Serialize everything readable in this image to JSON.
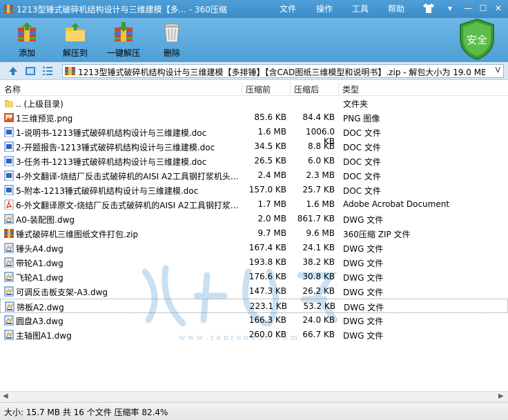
{
  "window": {
    "title": "1213型锤式破碎机结构设计与三维建模【多...  - 360压缩",
    "menu": [
      "文件",
      "操作",
      "工具",
      "帮助"
    ],
    "controls": {
      "minimize": "—",
      "maximize": "☐",
      "close": "✕"
    }
  },
  "toolbar": {
    "buttons": [
      {
        "label": "添加",
        "icon": "add-archive-icon"
      },
      {
        "label": "解压到",
        "icon": "extract-to-icon"
      },
      {
        "label": "一键解压",
        "icon": "one-click-extract-icon"
      },
      {
        "label": "删除",
        "icon": "delete-trash-icon"
      }
    ],
    "security_badge": "安全"
  },
  "address": {
    "path": "1213型锤式破碎机结构设计与三维建模【多排锤】【含CAD图纸三维模型和说明书】.zip - 解包大小为 19.0 MB",
    "dropdown": "V"
  },
  "columns": {
    "name": "名称",
    "size": "压缩前",
    "compressed": "压缩后",
    "type": "类型"
  },
  "files": [
    {
      "name": ".. (上级目录)",
      "size": "",
      "compressed": "",
      "type": "文件夹",
      "icon": "folder-icon"
    },
    {
      "name": "1三维预览.png",
      "size": "85.6 KB",
      "compressed": "84.4 KB",
      "type": "PNG 图像",
      "icon": "png-icon"
    },
    {
      "name": "1-说明书-1213锤式破碎机结构设计与三维建模.doc",
      "size": "1.6 MB",
      "compressed": "1006.0 KB",
      "type": "DOC 文件",
      "icon": "doc-icon"
    },
    {
      "name": "2-开题报告-1213锤式破碎机结构设计与三维建模.doc",
      "size": "34.5 KB",
      "compressed": "8.8 KB",
      "type": "DOC 文件",
      "icon": "doc-icon"
    },
    {
      "name": "3-任务书-1213锤式破碎机结构设计与三维建模.doc",
      "size": "26.5 KB",
      "compressed": "6.0 KB",
      "type": "DOC 文件",
      "icon": "doc-icon"
    },
    {
      "name": "4-外文翻译-烧结厂反击式破碎机的AISI A2工具钢打浆机头...",
      "size": "2.4 MB",
      "compressed": "2.3 MB",
      "type": "DOC 文件",
      "icon": "doc-icon"
    },
    {
      "name": "5-附本-1213锤式破碎机结构设计与三维建模.doc",
      "size": "157.0 KB",
      "compressed": "25.7 KB",
      "type": "DOC 文件",
      "icon": "doc-icon"
    },
    {
      "name": "6-外文翻译原文-烧结厂反击式破碎机的AISI A2工具钢打浆...",
      "size": "1.7 MB",
      "compressed": "1.6 MB",
      "type": "Adobe Acrobat Document",
      "icon": "pdf-icon"
    },
    {
      "name": "A0-装配图.dwg",
      "size": "2.0 MB",
      "compressed": "861.7 KB",
      "type": "DWG 文件",
      "icon": "dwg-icon"
    },
    {
      "name": "锤式破碎机三维图纸文件打包.zip",
      "size": "9.7 MB",
      "compressed": "9.6 MB",
      "type": "360压缩 ZIP 文件",
      "icon": "zip-icon"
    },
    {
      "name": "锤头A4.dwg",
      "size": "167.4 KB",
      "compressed": "24.1 KB",
      "type": "DWG 文件",
      "icon": "dwg-icon"
    },
    {
      "name": "带轮A1.dwg",
      "size": "193.8 KB",
      "compressed": "38.2 KB",
      "type": "DWG 文件",
      "icon": "dwg-icon"
    },
    {
      "name": "飞轮A1.dwg",
      "size": "176.6 KB",
      "compressed": "30.8 KB",
      "type": "DWG 文件",
      "icon": "dwg-icon"
    },
    {
      "name": "可调反击板支架-A3.dwg",
      "size": "147.3 KB",
      "compressed": "26.2 KB",
      "type": "DWG 文件",
      "icon": "dwg-icon"
    },
    {
      "name": "筛板A2.dwg",
      "size": "223.1 KB",
      "compressed": "53.2 KB",
      "type": "DWG 文件",
      "icon": "dwg-icon",
      "selected": true
    },
    {
      "name": "圆盘A3.dwg",
      "size": "166.3 KB",
      "compressed": "24.0 KB",
      "type": "DWG 文件",
      "icon": "dwg-icon"
    },
    {
      "name": "主轴图A1.dwg",
      "size": "260.0 KB",
      "compressed": "66.7 KB",
      "type": "DWG 文件",
      "icon": "dwg-icon"
    }
  ],
  "watermark": {
    "text": "w w w . r e n r e n d o c . c o m"
  },
  "status": {
    "text": "大小: 15.7 MB 共 16 个文件 压缩率 82.4%"
  }
}
